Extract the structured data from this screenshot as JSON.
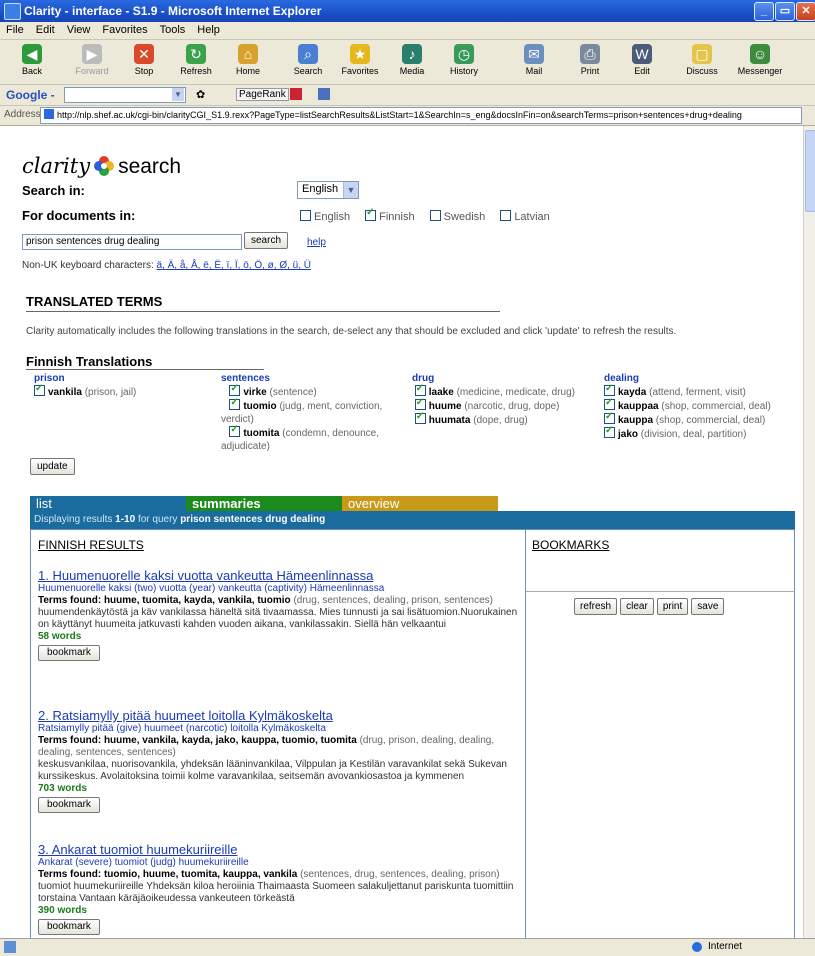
{
  "window": {
    "title": "Clarity - interface - S1.9 - Microsoft Internet Explorer"
  },
  "menu": [
    "File",
    "Edit",
    "View",
    "Favorites",
    "Tools",
    "Help"
  ],
  "toolbar": [
    "Back",
    "Forward",
    "Stop",
    "Refresh",
    "Home",
    "Search",
    "Favorites",
    "Media",
    "History",
    "Mail",
    "Print",
    "Edit",
    "Discuss",
    "Messenger"
  ],
  "google": {
    "label": "Google -",
    "pagerank": "PageRank"
  },
  "address": {
    "label": "Address",
    "url": "http://nlp.shef.ac.uk/cgi-bin/clarityCGI_S1.9.rexx?PageType=listSearchResults&ListStart=1&SearchIn=s_eng&docsInFin=on&searchTerms=prison+sentences+drug+dealing"
  },
  "logo": {
    "clarity": "clarity",
    "search": "search"
  },
  "search_in": {
    "label": "Search in:",
    "value": "English"
  },
  "documents_in": {
    "label": "For documents in:",
    "options": [
      {
        "name": "English",
        "checked": false
      },
      {
        "name": "Finnish",
        "checked": true
      },
      {
        "name": "Swedish",
        "checked": false
      },
      {
        "name": "Latvian",
        "checked": false
      }
    ]
  },
  "query": {
    "value": "prison sentences drug dealing",
    "search_label": "search",
    "help_label": "help"
  },
  "keyboard": {
    "label": "Non-UK keyboard characters:",
    "chars": "ä, Ä, å, Å, ë, Ë, ï, Ï, ö, Ö, ø, Ø, ü, Ü"
  },
  "translated": {
    "heading": "TRANSLATED TERMS",
    "desc": "Clarity automatically includes the following translations in the search, de-select any that should be excluded and click 'update' to refresh the results.",
    "finnish_heading": "Finnish Translations",
    "columns": [
      {
        "term": "prison",
        "entries": [
          {
            "word": "vankila",
            "gloss": "(prison, jail)"
          }
        ]
      },
      {
        "term": "sentences",
        "entries": [
          {
            "word": "virke",
            "gloss": "(sentence)"
          },
          {
            "word": "tuomio",
            "gloss": "(judg, ment, conviction, verdict)"
          },
          {
            "word": "tuomita",
            "gloss": "(condemn, denounce, adjudicate)"
          }
        ]
      },
      {
        "term": "drug",
        "entries": [
          {
            "word": "laake",
            "gloss": "(medicine, medicate, drug)"
          },
          {
            "word": "huume",
            "gloss": "(narcotic, drug, dope)"
          },
          {
            "word": "huumata",
            "gloss": "(dope, drug)"
          }
        ]
      },
      {
        "term": "dealing",
        "entries": [
          {
            "word": "kayda",
            "gloss": "(attend, ferment, visit)"
          },
          {
            "word": "kauppaa",
            "gloss": "(shop, commercial, deal)"
          },
          {
            "word": "kauppa",
            "gloss": "(shop, commercial, deal)"
          },
          {
            "word": "jako",
            "gloss": "(division, deal, partition)"
          }
        ]
      }
    ],
    "update_label": "update"
  },
  "tabs": [
    {
      "label": "list",
      "color": "#1a6b9e"
    },
    {
      "label": "summaries",
      "color": "#1d8a1d"
    },
    {
      "label": "overview",
      "color": "#c99a1a"
    }
  ],
  "results_bar": {
    "prefix": "Displaying results",
    "range": "1-10",
    "mid": "for query",
    "query": "prison sentences drug dealing"
  },
  "results": {
    "heading": "FINNISH RESULTS",
    "items": [
      {
        "title": "1. Huumenuorelle kaksi vuotta vankeutta Hämeenlinnassa",
        "gloss": "Huumenuorelle kaksi (two) vuotta (year) vankeutta (captivity) Hämeenlinnassa",
        "terms_label": "Terms found:",
        "terms": "huume, tuomita, kayda, vankila, tuomio",
        "terms_gloss": "(drug, sentences, dealing, prison, sentences)",
        "snippet": "huumendenkäytöstä ja käv vankilassa häneltä sitä tivaamassa. Mies tunnusti ja sai lisätuomion.Nuorukainen on käyttänyt huumeita jatkuvasti kahden vuoden aikana, vankilassakin. Siellä hän velkaantui",
        "words": "58 words",
        "bookmark": "bookmark"
      },
      {
        "title": "2. Ratsiamylly pitää huumeet loitolla Kylmäkoskelta",
        "gloss": "Ratsiamylly pitää (give) huumeet (narcotic) loitolla Kylmäkoskelta",
        "terms_label": "Terms found:",
        "terms": "huume, vankila, kayda, jako, kauppa, tuomio, tuomita",
        "terms_gloss": "(drug, prison, dealing, dealing, dealing, sentences, sentences)",
        "snippet": "keskusvankilaa, nuorisovankila, yhdeksän lääninvankilaa, Vilppulan ja Kestilän varavankilat sekä Sukevan kurssikeskus. Avolaitoksina toimii kolme varavankilaa, seitsemän avovankiosastoa ja kymmenen",
        "words": "703 words",
        "bookmark": "bookmark"
      },
      {
        "title": "3. Ankarat tuomiot huumekuriireille",
        "gloss": "Ankarat (severe) tuomiot (judg) huumekuriireille",
        "terms_label": "Terms found:",
        "terms": "tuomio, huume, tuomita, kauppa, vankila",
        "terms_gloss": "(sentences, drug, sentences, dealing, prison)",
        "snippet": "tuomiot huumekuriireille Yhdeksän kiloa heroiinia Thaimaasta Suomeen salakuljettanut pariskunta tuomittiin torstaina Vantaan käräjäoikeudessa vankeuteen törkeästä",
        "words": "390 words",
        "bookmark": "bookmark"
      }
    ]
  },
  "bookmarks": {
    "heading": "BOOKMARKS",
    "buttons": [
      "refresh",
      "clear",
      "print",
      "save"
    ]
  },
  "status": {
    "zone": "Internet"
  }
}
